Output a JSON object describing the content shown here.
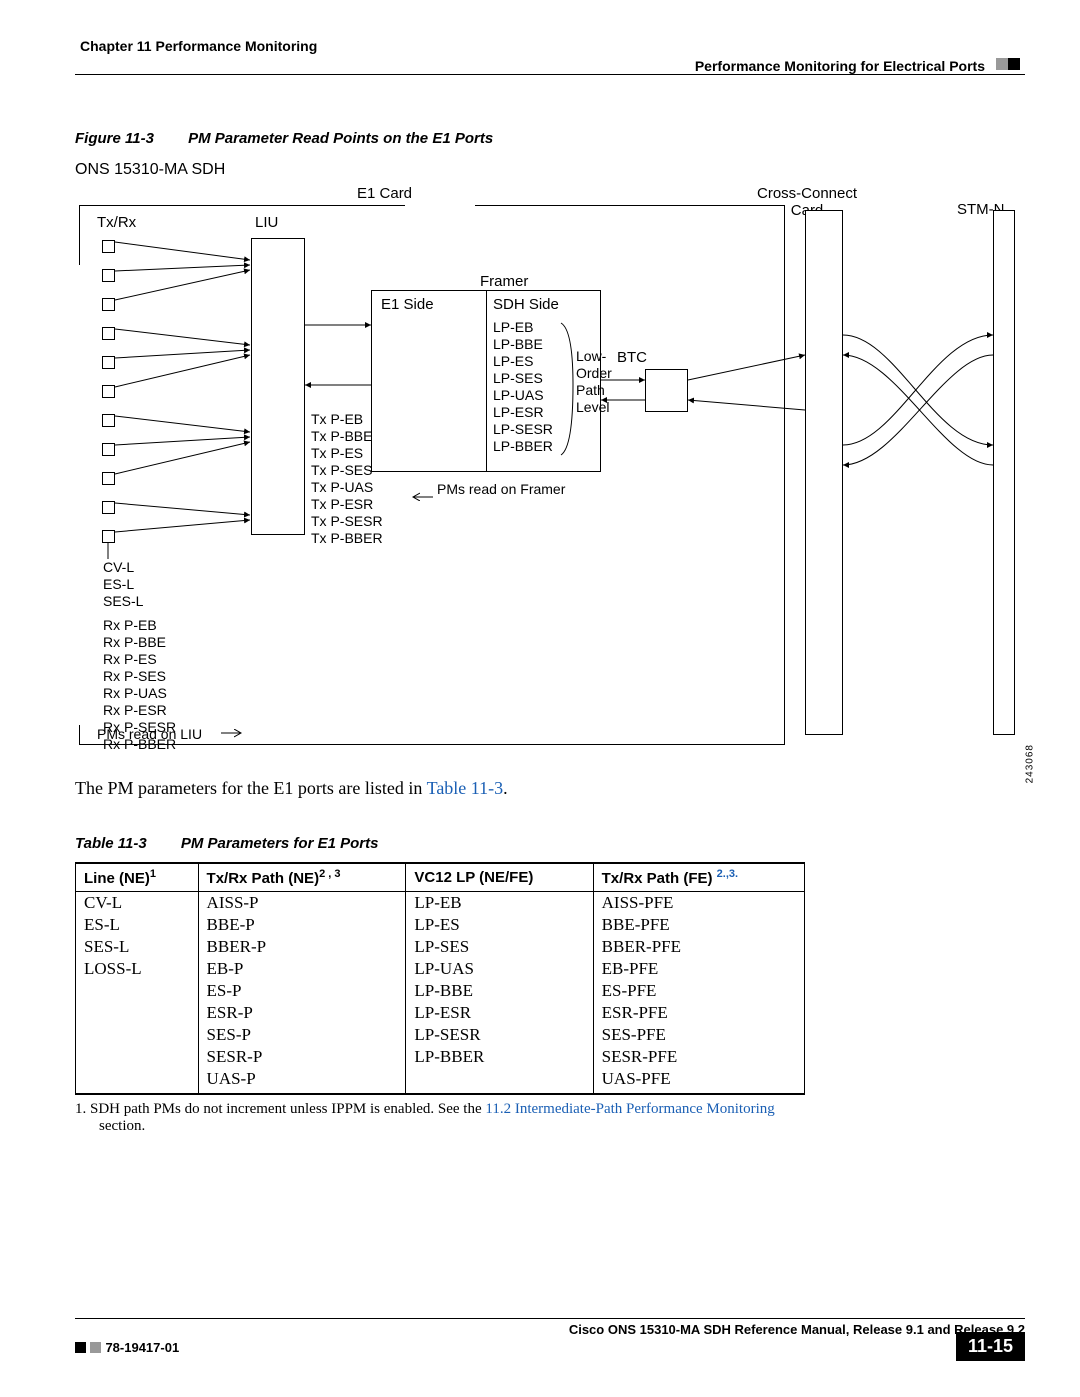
{
  "header": {
    "chapter": "Chapter 11    Performance Monitoring",
    "section": "Performance Monitoring for Electrical Ports"
  },
  "figure": {
    "label": "Figure 11-3",
    "title": "PM Parameter Read Points on the E1 Ports",
    "subtitle": "ONS 15310-MA SDH",
    "figid": "243068",
    "labels": {
      "e1card": "E1 Card",
      "txrx": "Tx/Rx",
      "liu": "LIU",
      "framer": "Framer",
      "e1side": "E1 Side",
      "sdhside": "SDH Side",
      "loworder": "Low-\nOrder\nPath\nLevel",
      "btc": "BTC",
      "crossconnect": "Cross-Connect\nCard",
      "stmn": "STM-N",
      "pms_framer": "PMs read on Framer",
      "pms_liu": "PMs read on LIU"
    },
    "fr_right": [
      "LP-EB",
      "LP-BBE",
      "LP-ES",
      "LP-SES",
      "LP-UAS",
      "LP-ESR",
      "LP-SESR",
      "LP-BBER"
    ],
    "tx_list": [
      "Tx P-EB",
      "Tx P-BBE",
      "Tx P-ES",
      "Tx P-SES",
      "Tx P-UAS",
      "Tx P-ESR",
      "Tx P-SESR",
      "Tx P-BBER"
    ],
    "cv_list": [
      "CV-L",
      "ES-L",
      "SES-L"
    ],
    "rx_list": [
      "Rx P-EB",
      "Rx P-BBE",
      "Rx P-ES",
      "Rx P-SES",
      "Rx P-UAS",
      "Rx P-ESR",
      "Rx P-SESR",
      "Rx P-BBER"
    ]
  },
  "paragraph": {
    "text_a": "The PM parameters for the E1 ports are listed in ",
    "link": "Table 11-3",
    "text_b": "."
  },
  "table": {
    "label": "Table 11-3",
    "title": "PM Parameters for E1 Ports",
    "headers": [
      "Line (NE)",
      "Tx/Rx Path (NE)",
      "VC12 LP (NE/FE)",
      "Tx/Rx Path (FE) "
    ],
    "header_sups": [
      "1",
      "2 , 3",
      "",
      "2.,3."
    ],
    "cols": [
      [
        "CV-L",
        "ES-L",
        "SES-L",
        "LOSS-L",
        "",
        "",
        "",
        "",
        ""
      ],
      [
        "AISS-P",
        "BBE-P",
        "BBER-P",
        "EB-P",
        "ES-P",
        "ESR-P",
        "SES-P",
        "SESR-P",
        "UAS-P"
      ],
      [
        "LP-EB",
        "LP-ES",
        "LP-SES",
        "LP-UAS",
        "LP-BBE",
        "LP-ESR",
        "LP-SESR",
        "LP-BBER",
        ""
      ],
      [
        "AISS-PFE",
        "BBE-PFE",
        "BBER-PFE",
        "EB-PFE",
        "ES-PFE",
        "ESR-PFE",
        "SES-PFE",
        "SESR-PFE",
        "UAS-PFE"
      ]
    ]
  },
  "footnotes": {
    "f1_a": "1.   SDH path PMs do not increment unless IPPM is enabled. See the ",
    "f1_link": "11.2  Intermediate-Path Performance Monitoring",
    "f1_b": " section."
  },
  "footer": {
    "title": "Cisco ONS 15310-MA SDH Reference Manual, Release 9.1 and Release 9.2",
    "docid": "78-19417-01",
    "page": "11-15"
  }
}
